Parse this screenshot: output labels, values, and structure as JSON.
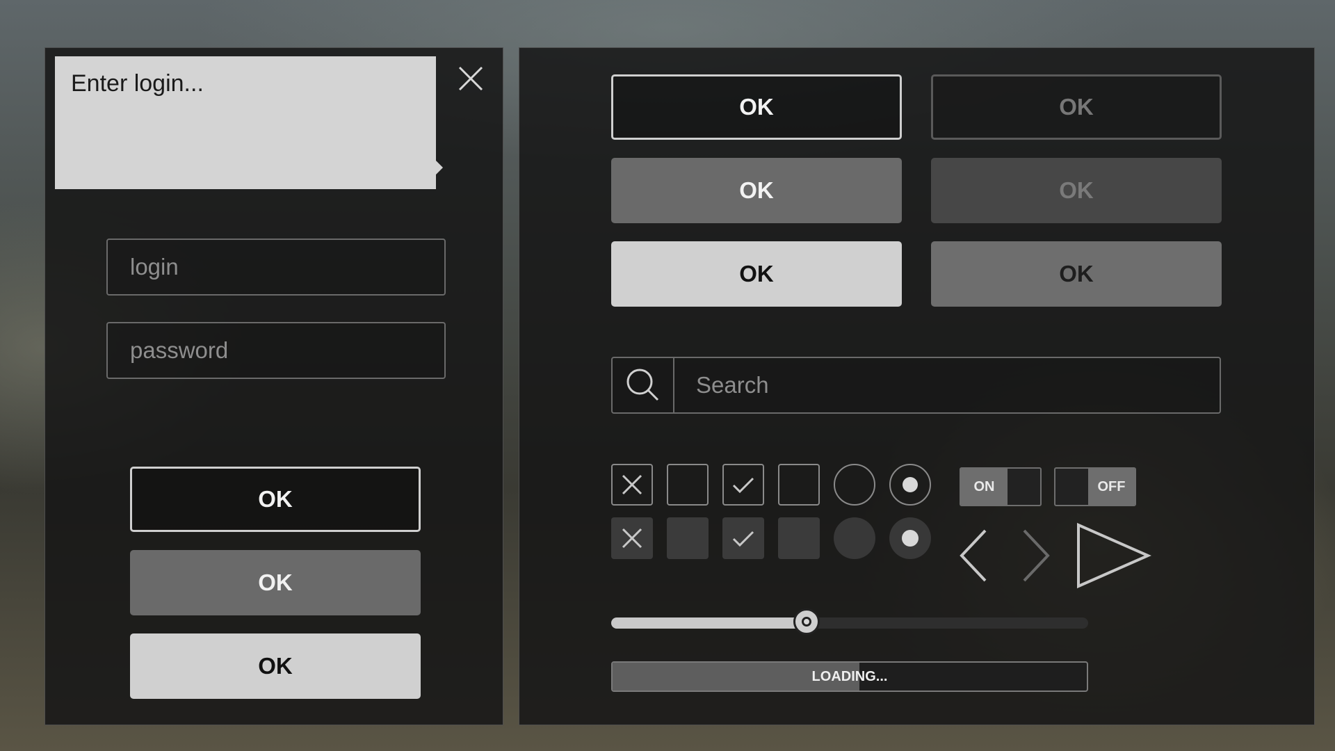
{
  "login_panel": {
    "tooltip_text": "Enter login...",
    "login_placeholder": "login",
    "password_placeholder": "password",
    "buttons": {
      "outline_label": "OK",
      "gray_label": "OK",
      "light_label": "OK"
    }
  },
  "controls_panel": {
    "buttons": [
      {
        "label": "OK"
      },
      {
        "label": "OK"
      },
      {
        "label": "OK"
      },
      {
        "label": "OK"
      },
      {
        "label": "OK"
      },
      {
        "label": "OK"
      }
    ],
    "search_placeholder": "Search",
    "toggle_on_label": "ON",
    "toggle_off_label": "OFF",
    "slider_value_percent": 41,
    "progress_percent": 52,
    "progress_text": "LOADING..."
  }
}
